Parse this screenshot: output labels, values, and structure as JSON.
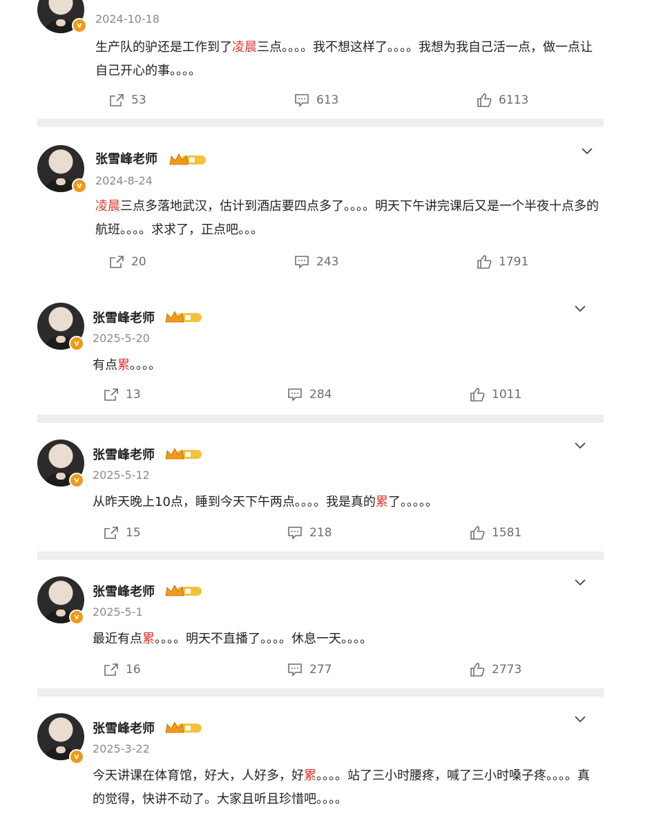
{
  "posts": [
    {
      "name": "",
      "date": "2024-10-18",
      "text": [
        {
          "t": "生产队的驴还是工作到了",
          "hl": false
        },
        {
          "t": "凌晨",
          "hl": true
        },
        {
          "t": "三点。。。。我不想这样了。。。。我想为我自己活一点，做一点让自己开心的事。。。。",
          "hl": false
        }
      ],
      "reposts": "53",
      "comments": "613",
      "likes": "6113"
    },
    {
      "name": "张雪峰老师",
      "date": "2024-8-24",
      "text": [
        {
          "t": "凌晨",
          "hl": true
        },
        {
          "t": "三点多落地武汉，估计到酒店要四点多了。。。。明天下午讲完课后又是一个半夜十点多的航班。。。。求求了，正点吧。。。",
          "hl": false
        }
      ],
      "reposts": "20",
      "comments": "243",
      "likes": "1791"
    },
    {
      "name": "张雪峰老师",
      "date": "2025-5-20",
      "text": [
        {
          "t": "有点",
          "hl": false
        },
        {
          "t": "累",
          "hl": true
        },
        {
          "t": "。。。。",
          "hl": false
        }
      ],
      "reposts": "13",
      "comments": "284",
      "likes": "1011"
    },
    {
      "name": "张雪峰老师",
      "date": "2025-5-12",
      "text": [
        {
          "t": "从昨天晚上10点，睡到今天下午两点。。。。我是真的",
          "hl": false
        },
        {
          "t": "累",
          "hl": true
        },
        {
          "t": "了。。。。。",
          "hl": false
        }
      ],
      "reposts": "15",
      "comments": "218",
      "likes": "1581"
    },
    {
      "name": "张雪峰老师",
      "date": "2025-5-1",
      "text": [
        {
          "t": "最近有点",
          "hl": false
        },
        {
          "t": "累",
          "hl": true
        },
        {
          "t": "。。。。明天不直播了。。。。休息一天。。。。",
          "hl": false
        }
      ],
      "reposts": "16",
      "comments": "277",
      "likes": "2773"
    },
    {
      "name": "张雪峰老师",
      "date": "2025-3-22",
      "text": [
        {
          "t": "今天讲课在体育馆，好大，人好多，好",
          "hl": false
        },
        {
          "t": "累",
          "hl": true
        },
        {
          "t": "。。。。站了三小时腰疼，喊了三小时嗓子疼。。。。真的觉得，快讲不动了。大家且听且珍惜吧。。。。",
          "hl": false
        }
      ],
      "reposts": "",
      "comments": "",
      "likes": ""
    }
  ],
  "colors": {
    "highlight": "#e2342d",
    "verified_badge": "#f09a1a",
    "separator": "#eeeeee",
    "icon": "#6d6d6d"
  },
  "icons": {
    "repost": "repost-icon",
    "comment": "comment-icon",
    "like": "like-icon",
    "more": "chevron-down-icon",
    "verified": "verified-badge-icon",
    "membership": "crown-badge-icon"
  }
}
